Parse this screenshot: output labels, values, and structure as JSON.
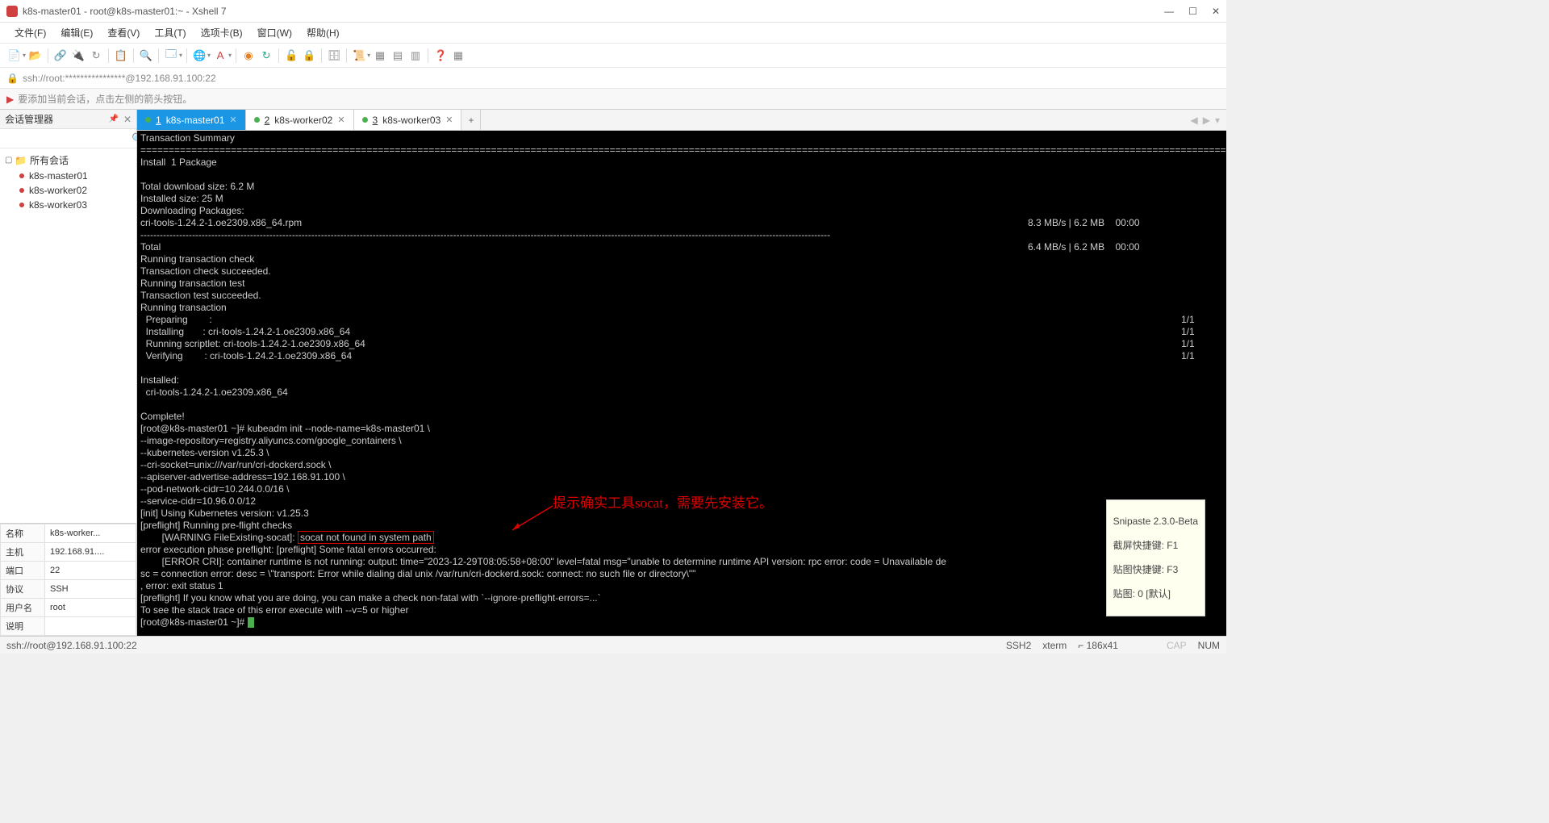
{
  "titlebar": {
    "title": "k8s-master01 - root@k8s-master01:~ - Xshell 7"
  },
  "menus": [
    "文件(F)",
    "编辑(E)",
    "查看(V)",
    "工具(T)",
    "选项卡(B)",
    "窗口(W)",
    "帮助(H)"
  ],
  "address": "ssh://root:****************@192.168.91.100:22",
  "hint": "要添加当前会话，点击左侧的箭头按钮。",
  "sidebar": {
    "title": "会话管理器",
    "root": "所有会话",
    "sessions": [
      "k8s-master01",
      "k8s-worker02",
      "k8s-worker03"
    ],
    "props": [
      {
        "k": "名称",
        "v": "k8s-worker..."
      },
      {
        "k": "主机",
        "v": "192.168.91...."
      },
      {
        "k": "端口",
        "v": "22"
      },
      {
        "k": "协议",
        "v": "SSH"
      },
      {
        "k": "用户名",
        "v": "root"
      },
      {
        "k": "说明",
        "v": ""
      }
    ]
  },
  "tabs": [
    {
      "num": "1",
      "label": "k8s-master01",
      "active": true
    },
    {
      "num": "2",
      "label": "k8s-worker02",
      "active": false
    },
    {
      "num": "3",
      "label": "k8s-worker03",
      "active": false
    }
  ],
  "annotation": "提示确实工具socat，需要先安装它。",
  "term": {
    "l1": "Transaction Summary",
    "l2": "======================================================================================================================================================================================================================",
    "l3": "Install  1 Package",
    "l4": "",
    "l5": "Total download size: 6.2 M",
    "l6": "Installed size: 25 M",
    "l7": "Downloading Packages:",
    "l8a": "cri-tools-1.24.2-1.oe2309.x86_64.rpm",
    "l8b": "8.3 MB/s | 6.2 MB    00:00",
    "l9": "----------------------------------------------------------------------------------------------------------------------------------------------------------------------------------------------------------------------",
    "l10a": "Total",
    "l10b": "6.4 MB/s | 6.2 MB    00:00",
    "l11": "Running transaction check",
    "l12": "Transaction check succeeded.",
    "l13": "Running transaction test",
    "l14": "Transaction test succeeded.",
    "l15": "Running transaction",
    "l16a": "  Preparing        :",
    "l16b": "1/1",
    "l17a": "  Installing       : cri-tools-1.24.2-1.oe2309.x86_64",
    "l17b": "1/1",
    "l18a": "  Running scriptlet: cri-tools-1.24.2-1.oe2309.x86_64",
    "l18b": "1/1",
    "l19a": "  Verifying        : cri-tools-1.24.2-1.oe2309.x86_64",
    "l19b": "1/1",
    "l20": "",
    "l21": "Installed:",
    "l22": "  cri-tools-1.24.2-1.oe2309.x86_64",
    "l23": "",
    "l24": "Complete!",
    "l25": "[root@k8s-master01 ~]# kubeadm init --node-name=k8s-master01 \\",
    "l26": "--image-repository=registry.aliyuncs.com/google_containers \\",
    "l27": "--kubernetes-version v1.25.3 \\",
    "l28": "--cri-socket=unix:///var/run/cri-dockerd.sock \\",
    "l29": "--apiserver-advertise-address=192.168.91.100 \\",
    "l30": "--pod-network-cidr=10.244.0.0/16 \\",
    "l31": "--service-cidr=10.96.0.0/12",
    "l32": "[init] Using Kubernetes version: v1.25.3",
    "l33": "[preflight] Running pre-flight checks",
    "l34a": "        [WARNING FileExisting-socat]: ",
    "l34b": "socat not found in system path",
    "l35": "error execution phase preflight: [preflight] Some fatal errors occurred:",
    "l36": "        [ERROR CRI]: container runtime is not running: output: time=\"2023-12-29T08:05:58+08:00\" level=fatal msg=\"unable to determine runtime API version: rpc error: code = Unavailable de",
    "l37": "sc = connection error: desc = \\\"transport: Error while dialing dial unix /var/run/cri-dockerd.sock: connect: no such file or directory\\\"\"",
    "l38": ", error: exit status 1",
    "l39": "[preflight] If you know what you are doing, you can make a check non-fatal with `--ignore-preflight-errors=...`",
    "l40": "To see the stack trace of this error execute with --v=5 or higher",
    "l41": "[root@k8s-master01 ~]# "
  },
  "tooltip": {
    "l1": "Snipaste 2.3.0-Beta",
    "l2": "截屏快捷键: F1",
    "l3": "贴图快捷键: F3",
    "l4": "贴图: 0 [默认]"
  },
  "status": {
    "left": "ssh://root@192.168.91.100:22",
    "s1": "SSH2",
    "s2": "xterm",
    "s3": "⌐ 186x41",
    "s4": "CAP",
    "s5": "NUM"
  },
  "icons": {
    "min": "—",
    "max": "☐",
    "close": "✕",
    "pin": "📌",
    "x": "✕",
    "mag": "🔍",
    "plus": "+",
    "left": "◀",
    "right": "▶",
    "down": "▾",
    "flag": "▶",
    "lock": "🔒"
  }
}
